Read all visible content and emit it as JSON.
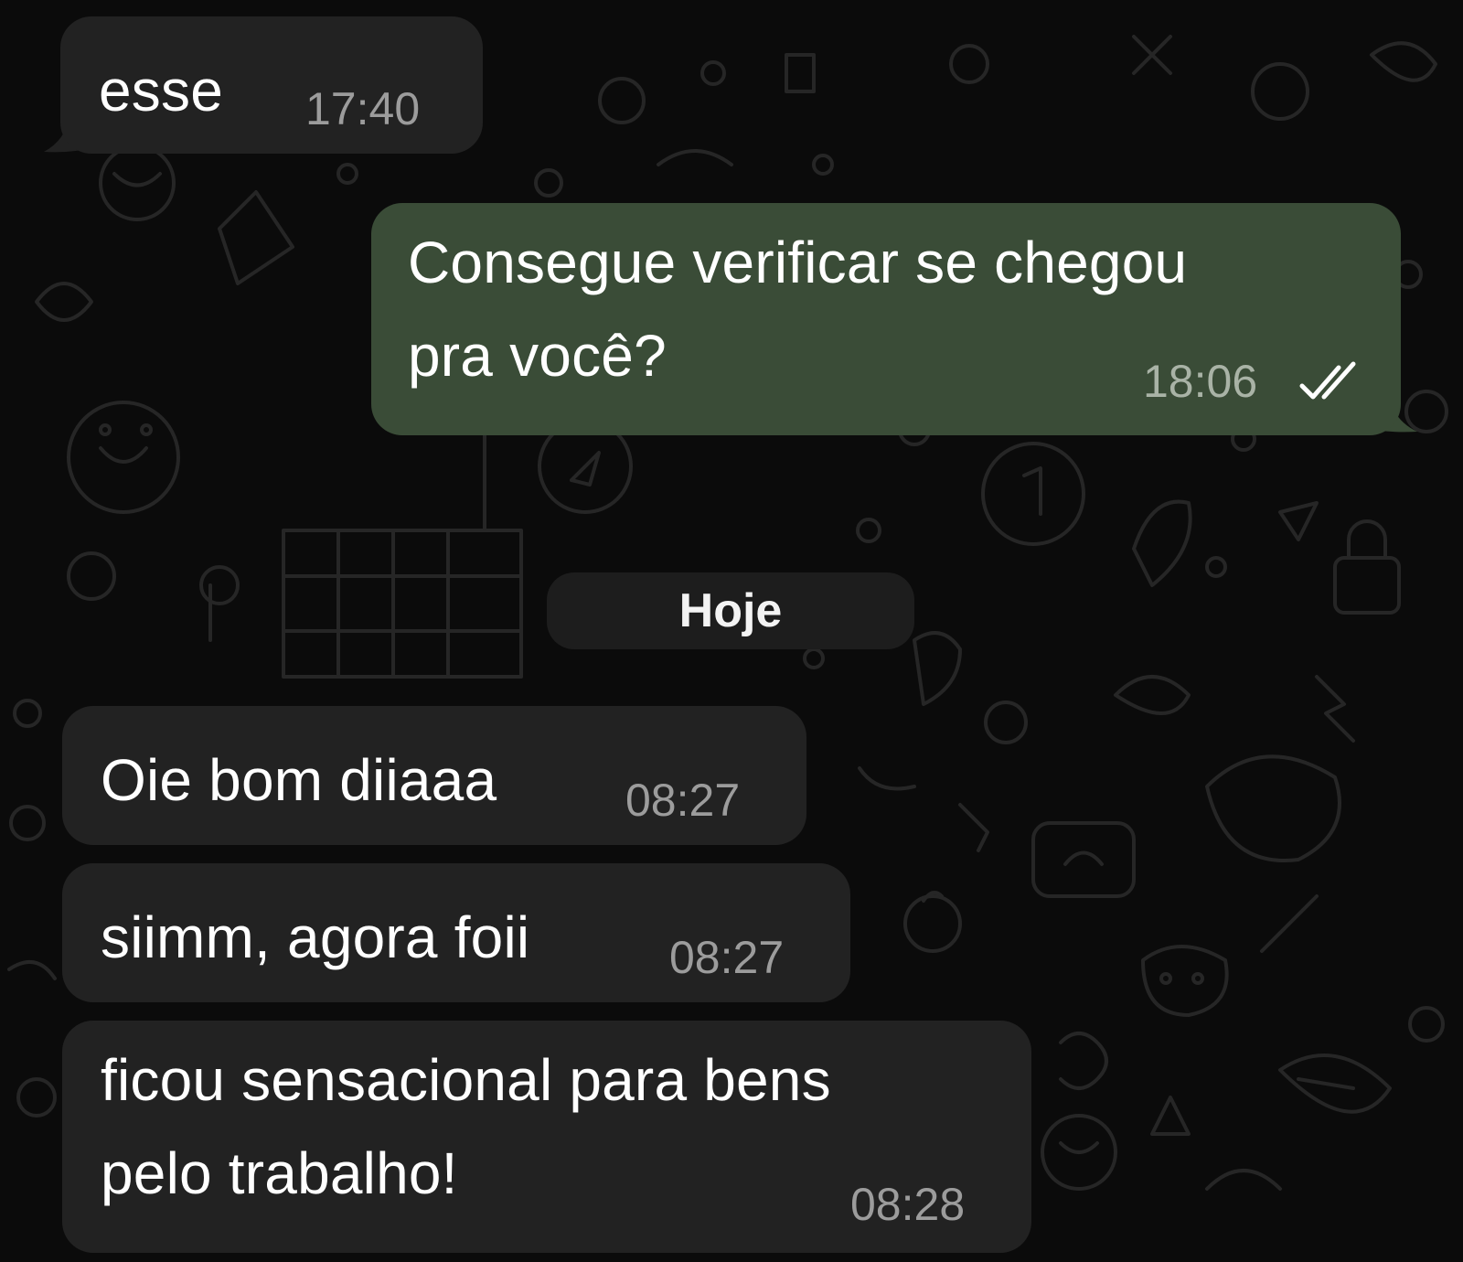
{
  "conversation": {
    "messages": [
      {
        "direction": "incoming",
        "text": "esse",
        "time": "17:40"
      },
      {
        "direction": "outgoing",
        "text_lines": [
          "Consegue verificar se chegou",
          "pra você?"
        ],
        "time": "18:06",
        "status_icon": "double-check-icon"
      },
      {
        "direction": "incoming",
        "text": "Oie bom diiaaa",
        "time": "08:27"
      },
      {
        "direction": "incoming",
        "text": "siimm, agora foii",
        "time": "08:27"
      },
      {
        "direction": "incoming",
        "text_lines": [
          "ficou sensacional para bens",
          "pelo trabalho!"
        ],
        "time": "08:28"
      }
    ],
    "date_separator": "Hoje"
  },
  "colors": {
    "background": "#0b0b0b",
    "incoming_bubble": "#222222",
    "outgoing_bubble": "#3a4c37",
    "timestamp": "#9c9c9c",
    "doodle_stroke": "#2a2a2a"
  }
}
